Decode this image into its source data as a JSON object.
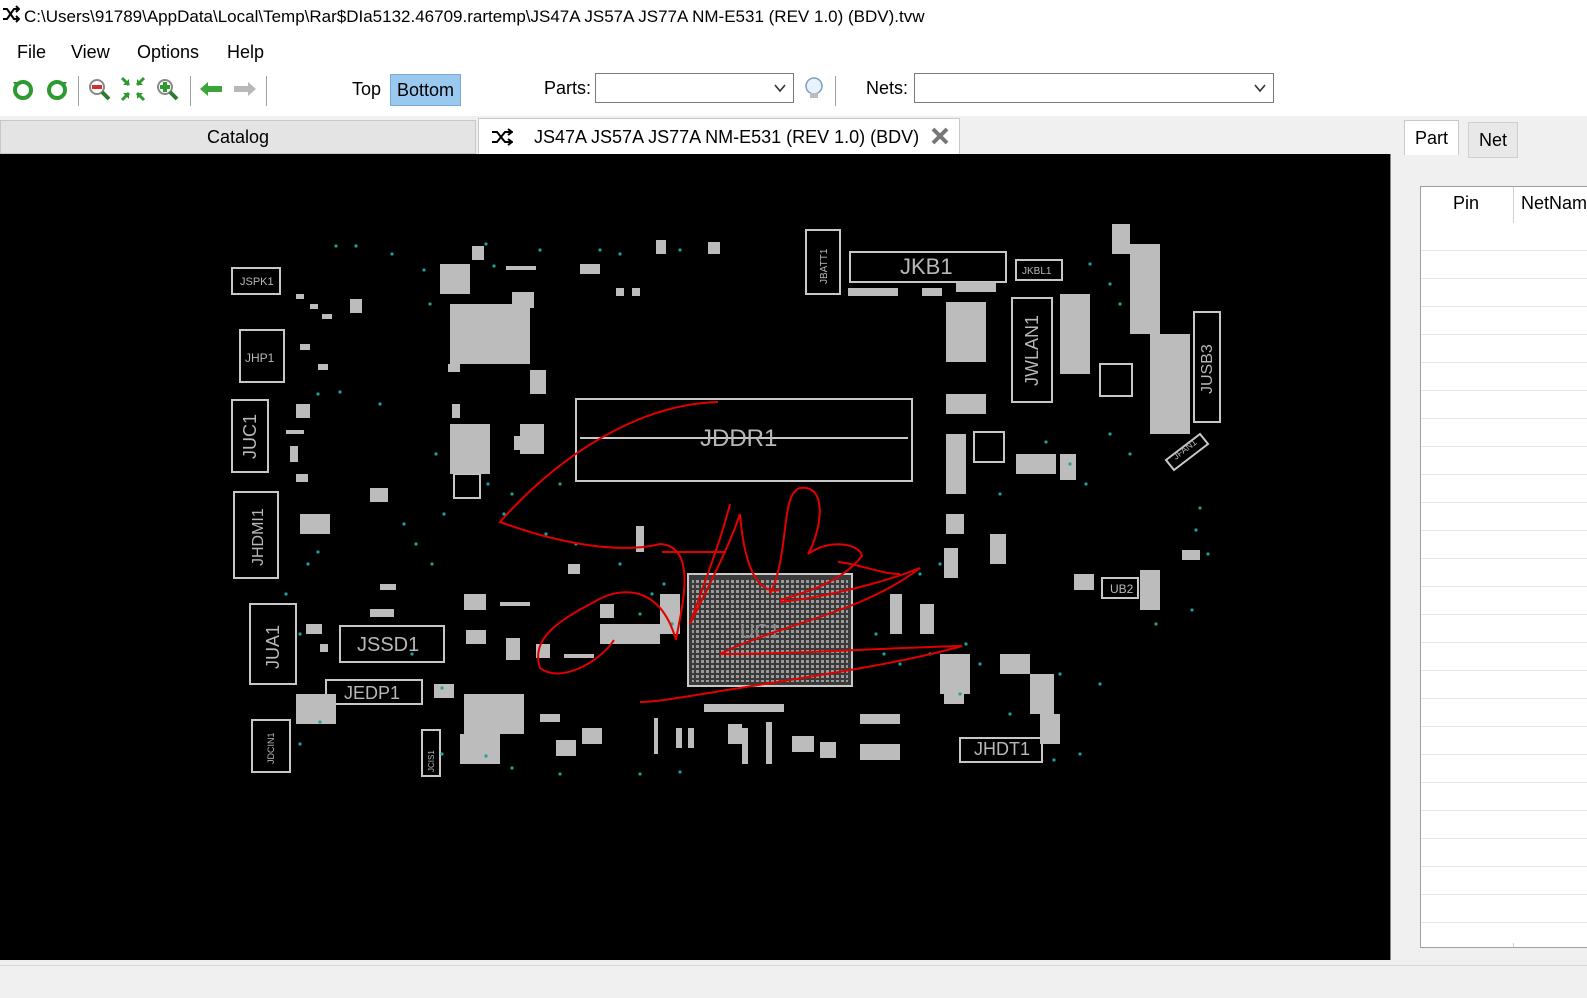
{
  "window": {
    "title": "C:\\Users\\91789\\AppData\\Local\\Temp\\Rar$DIa5132.46709.rartemp\\JS47A JS57A JS77A NM-E531 (REV 1.0) (BDV).tvw"
  },
  "menu": [
    "File",
    "View",
    "Options",
    "Help"
  ],
  "toolbar": {
    "top_label": "Top",
    "bottom_label": "Bottom",
    "parts_label": "Parts:",
    "parts_value": "",
    "nets_label": "Nets:",
    "nets_value": ""
  },
  "tabs": {
    "catalog": "Catalog",
    "document": "JS47A JS57A JS77A NM-E531 (REV 1.0) (BDV)"
  },
  "board": {
    "components": [
      "JSPK1",
      "JHP1",
      "JUC1",
      "JHDMI1",
      "JUA1",
      "JSSD1",
      "JEDP1",
      "JDCIN1",
      "JDDR1",
      "JKB1",
      "JKBL1",
      "JBATT1",
      "JWLAN1",
      "JUSB3",
      "JFAN1",
      "UB2",
      "UC1",
      "JHDT1",
      "JCIS1"
    ]
  },
  "right_panel": {
    "tabs": [
      "Part",
      "Net"
    ],
    "columns": [
      "Pin",
      "NetName"
    ]
  },
  "colors": {
    "accent": "#99c9ef",
    "board_bg": "#000000",
    "silk": "#c8c8c8",
    "pin": "#1aa3a3",
    "annotation": "#e00000"
  }
}
